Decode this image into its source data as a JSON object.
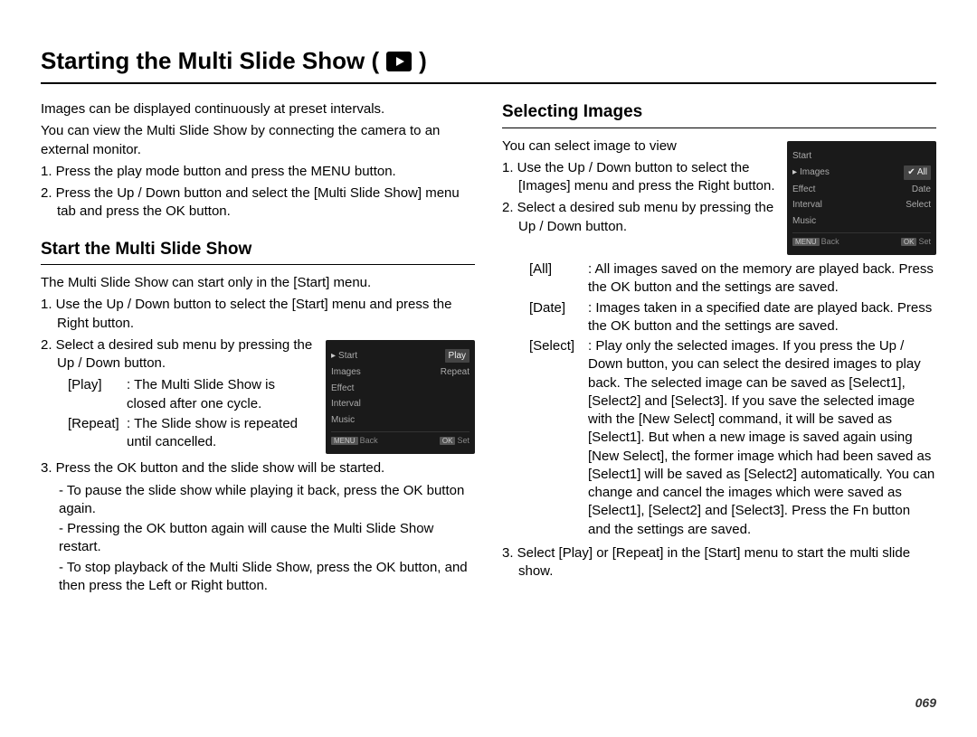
{
  "title_prefix": "Starting the Multi Slide Show (",
  "title_suffix": " )",
  "intro": {
    "p1": "Images can be displayed continuously at preset intervals.",
    "p2": "You can view the Multi Slide Show by connecting the camera to an external monitor.",
    "step1": "1. Press the play mode button and press the MENU button.",
    "step2": "2. Press the Up / Down button and select the [Multi Slide Show] menu tab and press the OK button."
  },
  "left": {
    "heading": "Start the Multi Slide Show",
    "p1": "The Multi Slide Show can start only in the [Start] menu.",
    "step1": "1. Use the Up / Down button to select the [Start] menu and press the Right button.",
    "step2": "2. Select a desired sub menu by pressing the Up / Down button.",
    "def_play_key": "[Play]",
    "def_play_val": ": The Multi Slide Show is closed after one cycle.",
    "def_repeat_key": "[Repeat]",
    "def_repeat_val": ": The Slide show is repeated until cancelled.",
    "step3": "3. Press the OK button and the slide show will be started.",
    "step3_b1": "- To pause the slide show while playing it back, press the OK button again.",
    "step3_b2": "- Pressing the OK button again will cause the Multi Slide Show restart.",
    "step3_b3": "- To stop playback of the Multi Slide Show, press the OK button, and then press the Left or Right button."
  },
  "right": {
    "heading": "Selecting Images",
    "p1": "You can select image to view",
    "step1": "1. Use the Up / Down button to select the [Images] menu and press the Right button.",
    "step2": "2. Select a desired sub menu by pressing the Up / Down button.",
    "def_all_key": "[All]",
    "def_all_val": ": All images saved on the memory are played back. Press the OK button and the settings are saved.",
    "def_date_key": "[Date]",
    "def_date_val": ": Images taken in a specified date are played back. Press the OK button and the settings are saved.",
    "def_select_key": "[Select]",
    "def_select_val": ": Play only the selected images. If you press the Up / Down button, you can select the desired images to play back. The selected image can be saved as [Select1], [Select2] and [Select3]. If you save the selected image with the [New Select] command, it will be saved as [Select1]. But when a new image is saved again using [New Select], the former image which had been saved as [Select1] will be saved as [Select2] automatically. You can change and cancel the images which were saved as [Select1], [Select2] and [Select3]. Press the Fn button and the settings are saved.",
    "step3": "3. Select [Play] or [Repeat] in the [Start] menu to start the multi slide show."
  },
  "lcd1": {
    "items": [
      "Start",
      "Images",
      "Effect",
      "Interval",
      "Music"
    ],
    "sub": [
      "Play",
      "Repeat"
    ],
    "back": "Back",
    "set": "Set",
    "back_btn": "MENU",
    "set_btn": "OK"
  },
  "lcd2": {
    "items": [
      "Start",
      "Images",
      "Effect",
      "Interval",
      "Music"
    ],
    "sub": [
      "All",
      "Date",
      "Select"
    ],
    "check": "✔",
    "back": "Back",
    "set": "Set",
    "back_btn": "MENU",
    "set_btn": "OK"
  },
  "page_number": "069"
}
